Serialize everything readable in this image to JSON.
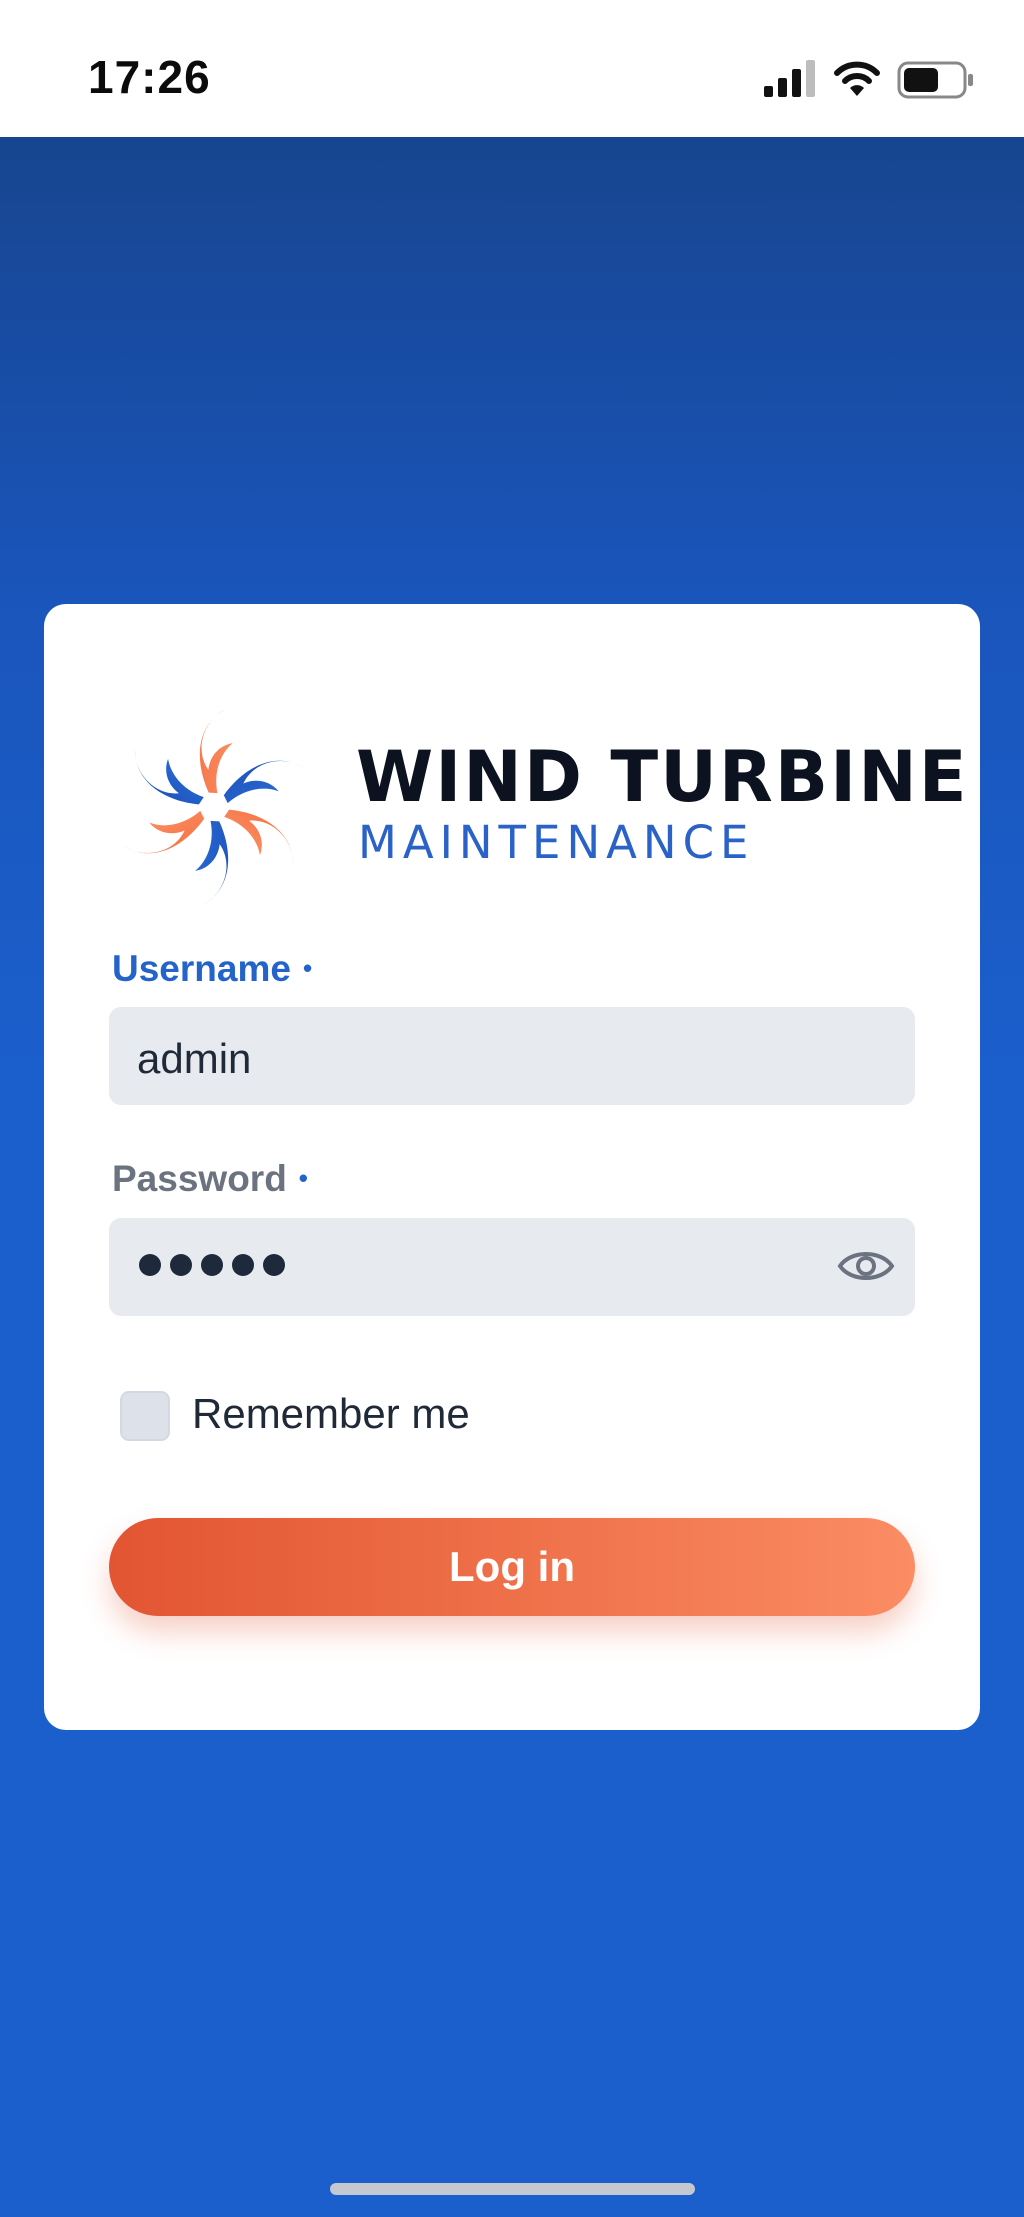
{
  "status_bar": {
    "time": "17:26",
    "icons": [
      "signal-icon",
      "wifi-icon",
      "battery-icon"
    ]
  },
  "brand": {
    "title": "WIND TURBINE",
    "subtitle": "MAINTENANCE",
    "logo_icon": "wind-turbine-logo-icon",
    "colors": {
      "primary": "#2463c9",
      "accent": "#ee7049",
      "dark": "#0d1220"
    }
  },
  "form": {
    "username": {
      "label": "Username",
      "value": "admin",
      "required_marker": "•"
    },
    "password": {
      "label": "Password",
      "masked_value": "•••••",
      "required_marker": "•",
      "toggle_icon": "eye-icon"
    },
    "remember": {
      "label": "Remember me",
      "checked": false
    },
    "submit_label": "Log in"
  }
}
